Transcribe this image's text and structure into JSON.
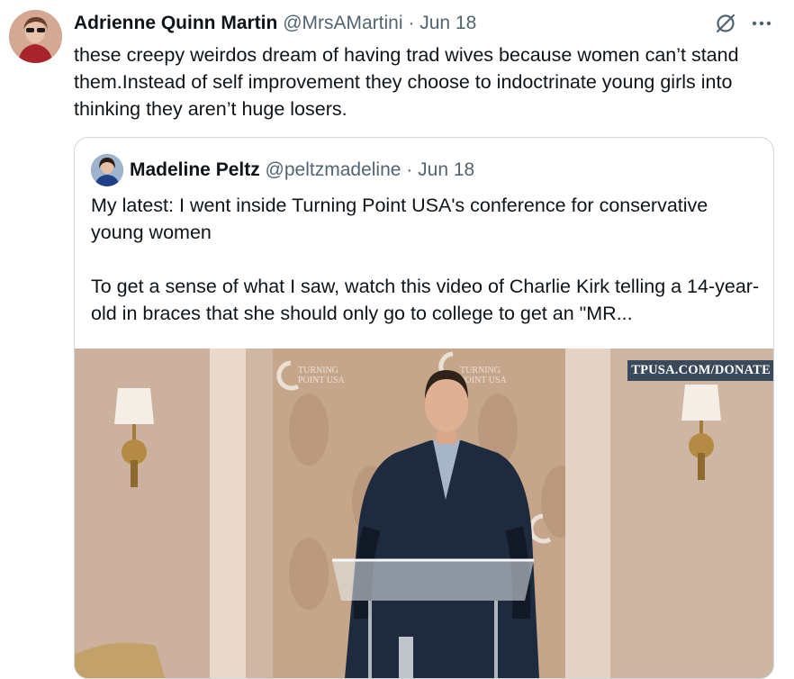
{
  "tweet": {
    "author_name": "Adrienne Quinn Martin",
    "handle": "@MrsAMartini",
    "separator": "·",
    "date": "Jun 18",
    "text": "these creepy weirdos dream of having trad wives because women can’t stand them.Instead of self improvement they choose to indoctrinate young girls into thinking they aren’t huge losers.",
    "icons": [
      "grok-icon",
      "more-icon"
    ]
  },
  "quote": {
    "author_name": "Madeline Peltz",
    "handle": "@peltzmadeline",
    "separator": "·",
    "date": "Jun 18",
    "text": "My latest: I went inside Turning Point USA's conference for conservative young women\n\nTo get a sense of what I saw, watch this video of Charlie Kirk telling a 14-year-old in braces that she should only go to college to get an \"MR...",
    "media": {
      "overlay_text": "TPUSA.COM/DONATE",
      "backdrop_logo_text": [
        "TURNING",
        "POINT USA"
      ]
    }
  }
}
